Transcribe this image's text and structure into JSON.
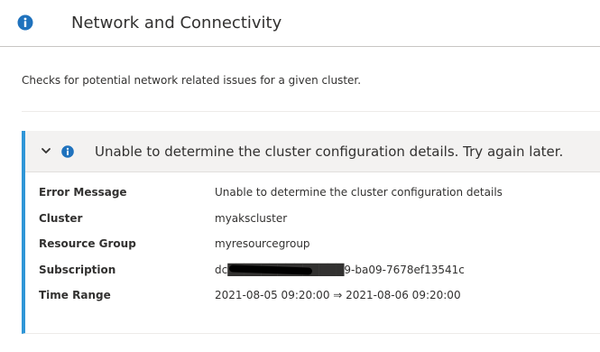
{
  "header": {
    "title": "Network and Connectivity",
    "icon": "info-icon"
  },
  "description": "Checks for potential network related issues for a given cluster.",
  "insight": {
    "expanded": true,
    "title": "Unable to determine the cluster configuration details. Try again later.",
    "accent_color": "#2f96d7",
    "details": [
      {
        "label": "Error Message",
        "value": "Unable to determine the cluster configuration details"
      },
      {
        "label": "Cluster",
        "value": "myakscluster"
      },
      {
        "label": "Resource Group",
        "value": "myresourcegroup"
      },
      {
        "label": "Subscription",
        "value": "dc██████████████9-ba09-7678ef13541c"
      },
      {
        "label": "Time Range",
        "value": "2021-08-05 09:20:00 ⇒ 2021-08-06 09:20:00"
      }
    ]
  }
}
